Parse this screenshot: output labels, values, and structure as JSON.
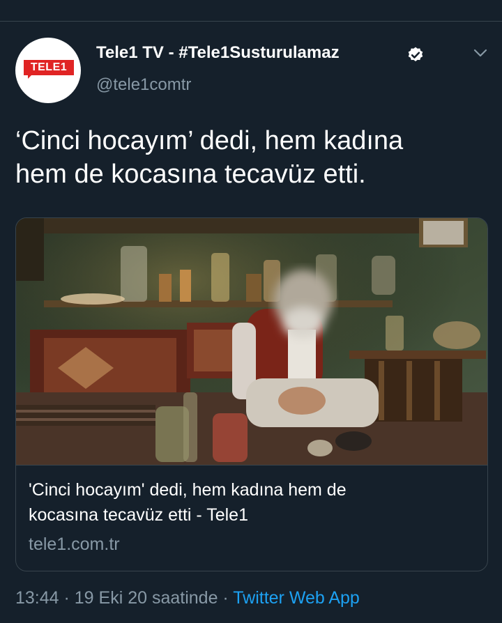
{
  "account": {
    "display_name": "Tele1 TV - #Tele1Susturulamaz",
    "handle": "@tele1comtr",
    "avatar_text": "TELE1",
    "verified": true
  },
  "tweet": {
    "text_line1": "‘Cinci hocayım’ dedi, hem kadına",
    "text_line2": "hem de kocasına tecavüz etti."
  },
  "link_card": {
    "title_line1": "'Cinci hocayım' dedi, hem kadına hem de",
    "title_line2": "kocasına tecavüz etti - Tele1",
    "domain": "tele1.com.tr"
  },
  "meta": {
    "time": "13:44",
    "sep1": " · ",
    "date": "19 Eki 20 saatinde",
    "sep2": " · ",
    "source": "Twitter Web App"
  },
  "colors": {
    "background": "#15202b",
    "secondary_text": "#8899a6",
    "link": "#1da1f2",
    "brand_red": "#e02424"
  },
  "icons": [
    "verified-badge-icon",
    "chevron-down-icon"
  ]
}
